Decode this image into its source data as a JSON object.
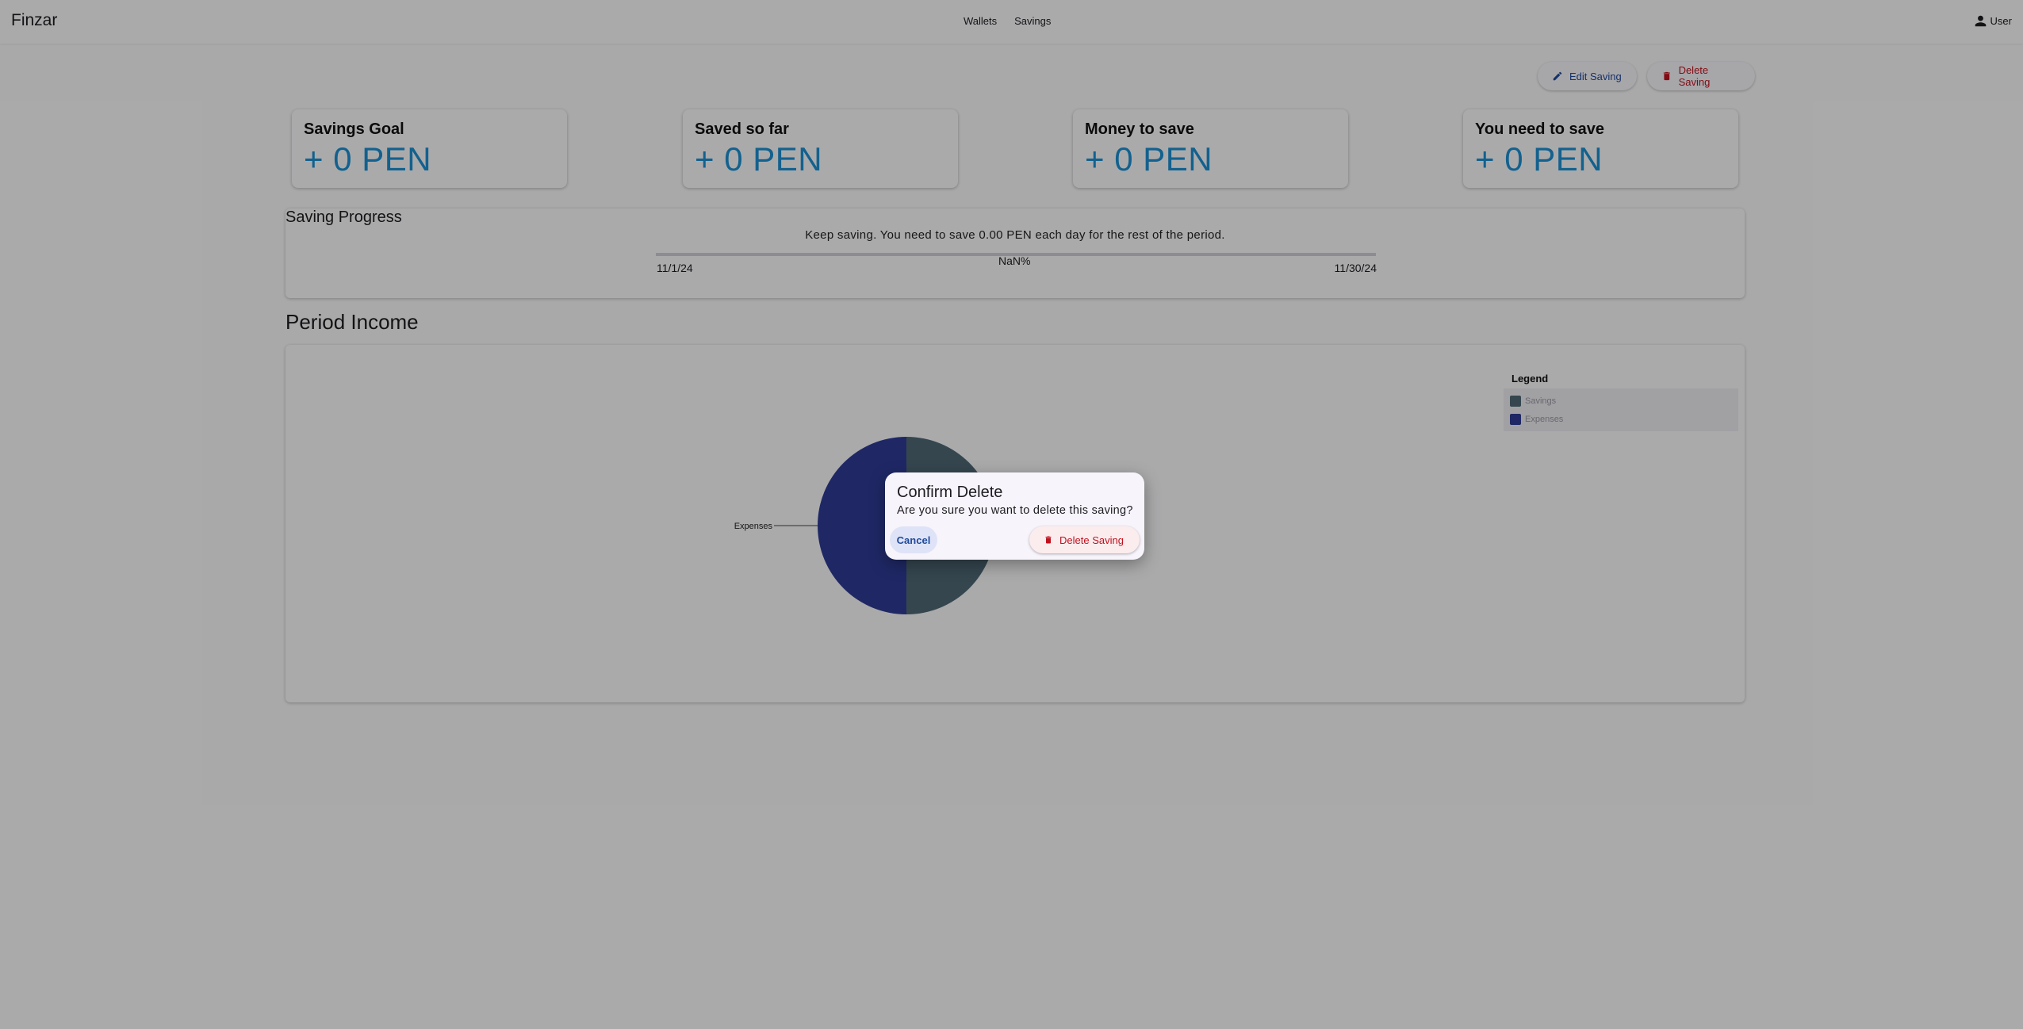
{
  "app": {
    "brand": "Finzar"
  },
  "nav": {
    "items": [
      "Wallets",
      "Savings"
    ],
    "user_label": "User"
  },
  "actions": {
    "edit_label": "Edit Saving",
    "delete_label": "Delete Saving"
  },
  "cards": [
    {
      "label": "Savings Goal",
      "value": "+ 0 PEN"
    },
    {
      "label": "Saved so far",
      "value": "+ 0 PEN"
    },
    {
      "label": "Money to save",
      "value": "+ 0 PEN"
    },
    {
      "label": "You need to save",
      "value": "+ 0 PEN"
    }
  ],
  "progress": {
    "title": "Saving Progress",
    "message": "Keep saving. You need to save 0.00 PEN each day for the rest of the period.",
    "start_date": "11/1/24",
    "end_date": "11/30/24",
    "percent_label": "NaN%",
    "fill_fraction": 0
  },
  "chart_section": {
    "title": "Period Income"
  },
  "chart_data": {
    "type": "pie",
    "slices": [
      {
        "label": "Savings",
        "value": 50,
        "color": "#4f6775"
      },
      {
        "label": "Expenses",
        "value": 50,
        "color": "#2f3c95"
      }
    ],
    "slice_labels_shown": [
      "Expenses"
    ],
    "legend": {
      "title": "Legend",
      "placement": "top-right",
      "entries": [
        "Savings",
        "Expenses"
      ]
    }
  },
  "dialog": {
    "title": "Confirm Delete",
    "message": "Are you sure you want to delete this saving?",
    "cancel_label": "Cancel",
    "confirm_label": "Delete Saving"
  },
  "colors": {
    "accent_blue": "#1b8fd1",
    "primary": "#1e4a9b",
    "danger": "#c0121e",
    "scrim": "rgba(0,0,0,0.32)"
  }
}
